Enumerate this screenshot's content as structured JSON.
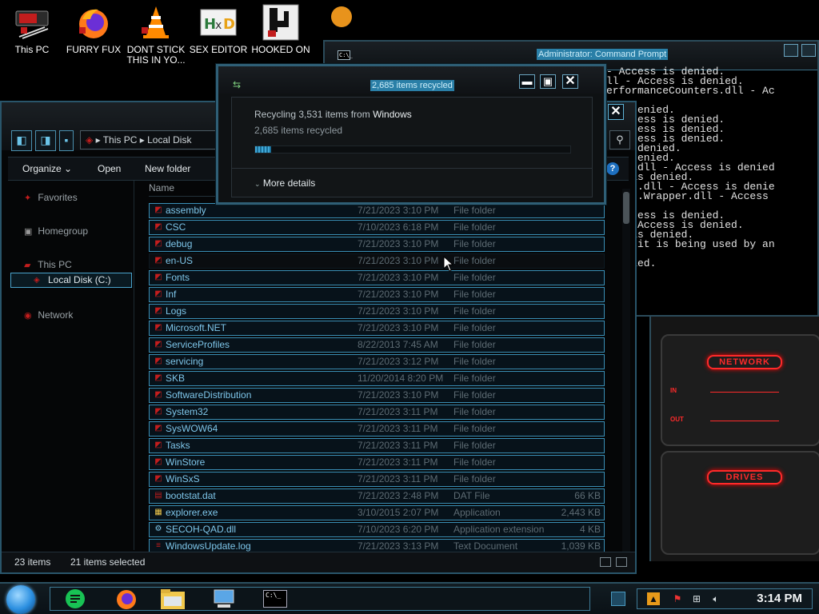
{
  "desktop": {
    "icons": [
      {
        "label": "This PC",
        "icon": "computer-icon"
      },
      {
        "label": "FURRY FUX",
        "icon": "firefox-icon"
      },
      {
        "label": "DONT STICK THIS IN YO...",
        "icon": "vlc-cone-icon"
      },
      {
        "label": "SEX EDITOR",
        "icon": "hxd-editor-icon"
      },
      {
        "label": "HOOKED ON",
        "icon": "game-icon"
      }
    ]
  },
  "cmd": {
    "title": "Administrator: Command Prompt",
    "icon_text": "C:\\_",
    "lines": [
      "- Access is denied.",
      "ll - Access is denied.",
      "erformanceCounters.dll - Ac",
      "",
      " is denied.",
      "- Access is denied.",
      "- Access is denied.",
      "- Access is denied.",
      "s is denied.",
      " is denied.",
      "ient.dll - Access is denied",
      "ess is denied.",
      "vices.dll - Access is denie",
      "vices.Wrapper.dll - Access",
      "",
      "- Access is denied.",
      "ll - Access is denied.",
      "ess is denied.",
      "ause it is being used by an",
      "",
      "ecified.",
      "fied."
    ]
  },
  "gadget": {
    "network_title": "NETWORK",
    "in_label": "IN",
    "out_label": "OUT",
    "drives_title": "DRIVES",
    "accent": "#ff2a2a"
  },
  "explorer": {
    "breadcrumb": [
      "This PC",
      "Local Disk"
    ],
    "toolbar": {
      "organize": "Organize",
      "open": "Open",
      "new_folder": "New folder"
    },
    "nav": {
      "favorites": "Favorites",
      "homegroup": "Homegroup",
      "this_pc": "This PC",
      "local_disk": "Local Disk (C:)",
      "network": "Network"
    },
    "column_name": "Name",
    "files": [
      {
        "name": "assembly",
        "date": "7/21/2023 3:10 PM",
        "type": "File folder",
        "size": "",
        "icon": "folder-icon"
      },
      {
        "name": "CSC",
        "date": "7/10/2023 6:18 PM",
        "type": "File folder",
        "size": "",
        "icon": "folder-icon"
      },
      {
        "name": "debug",
        "date": "7/21/2023 3:10 PM",
        "type": "File folder",
        "size": "",
        "icon": "folder-icon"
      },
      {
        "name": "en-US",
        "date": "7/21/2023 3:10 PM",
        "type": "File folder",
        "size": "",
        "icon": "folder-icon"
      },
      {
        "name": "Fonts",
        "date": "7/21/2023 3:10 PM",
        "type": "File folder",
        "size": "",
        "icon": "folder-icon"
      },
      {
        "name": "Inf",
        "date": "7/21/2023 3:10 PM",
        "type": "File folder",
        "size": "",
        "icon": "folder-icon"
      },
      {
        "name": "Logs",
        "date": "7/21/2023 3:10 PM",
        "type": "File folder",
        "size": "",
        "icon": "folder-icon"
      },
      {
        "name": "Microsoft.NET",
        "date": "7/21/2023 3:10 PM",
        "type": "File folder",
        "size": "",
        "icon": "folder-icon"
      },
      {
        "name": "ServiceProfiles",
        "date": "8/22/2013 7:45 AM",
        "type": "File folder",
        "size": "",
        "icon": "folder-icon"
      },
      {
        "name": "servicing",
        "date": "7/21/2023 3:12 PM",
        "type": "File folder",
        "size": "",
        "icon": "folder-icon"
      },
      {
        "name": "SKB",
        "date": "11/20/2014 8:20 PM",
        "type": "File folder",
        "size": "",
        "icon": "folder-icon"
      },
      {
        "name": "SoftwareDistribution",
        "date": "7/21/2023 3:10 PM",
        "type": "File folder",
        "size": "",
        "icon": "folder-icon"
      },
      {
        "name": "System32",
        "date": "7/21/2023 3:11 PM",
        "type": "File folder",
        "size": "",
        "icon": "folder-icon"
      },
      {
        "name": "SysWOW64",
        "date": "7/21/2023 3:11 PM",
        "type": "File folder",
        "size": "",
        "icon": "folder-icon"
      },
      {
        "name": "Tasks",
        "date": "7/21/2023 3:11 PM",
        "type": "File folder",
        "size": "",
        "icon": "folder-icon"
      },
      {
        "name": "WinStore",
        "date": "7/21/2023 3:11 PM",
        "type": "File folder",
        "size": "",
        "icon": "folder-icon"
      },
      {
        "name": "WinSxS",
        "date": "7/21/2023 3:11 PM",
        "type": "File folder",
        "size": "",
        "icon": "folder-icon"
      },
      {
        "name": "bootstat.dat",
        "date": "7/21/2023 2:48 PM",
        "type": "DAT File",
        "size": "66 KB",
        "icon": "dat-file-icon"
      },
      {
        "name": "explorer.exe",
        "date": "3/10/2015 2:07 PM",
        "type": "Application",
        "size": "2,443 KB",
        "icon": "explorer-exe-icon"
      },
      {
        "name": "SECOH-QAD.dll",
        "date": "7/10/2023 6:20 PM",
        "type": "Application extension",
        "size": "4 KB",
        "icon": "dll-file-icon"
      },
      {
        "name": "WindowsUpdate.log",
        "date": "7/21/2023 3:13 PM",
        "type": "Text Document",
        "size": "1,039 KB",
        "icon": "text-file-icon"
      }
    ],
    "status": {
      "count": "23 items",
      "selected": "21 items selected"
    }
  },
  "recycle": {
    "title": "2,685 items recycled",
    "line1_prefix": "Recycling 3,531 items from ",
    "line1_source": "Windows",
    "line2": "2,685 items recycled",
    "progress": 0.05,
    "more_details": "More details"
  },
  "taskbar": {
    "apps": [
      "notes-app-icon",
      "firefox-icon",
      "file-explorer-icon",
      "remote-desktop-icon",
      "command-prompt-icon"
    ],
    "cmd_icon_text": "C:\\_",
    "clock": "3:14 PM"
  }
}
